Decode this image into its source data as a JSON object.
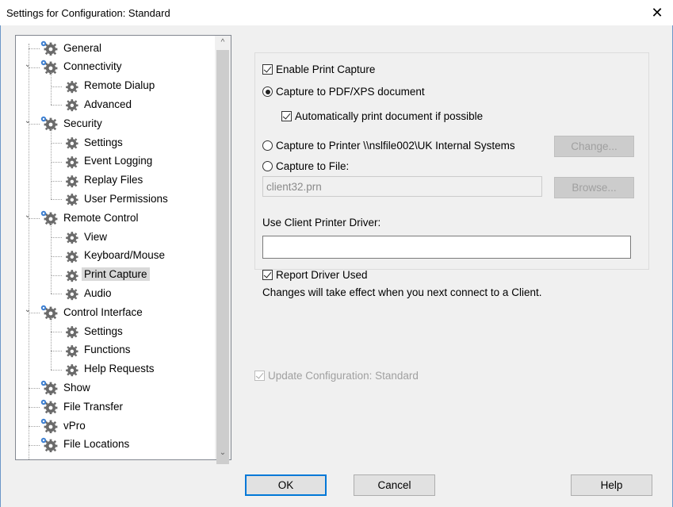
{
  "window": {
    "title": "Settings for Configuration: Standard",
    "close_label": "✕"
  },
  "tree": {
    "items": [
      {
        "label": "General",
        "level": 0,
        "expander": ""
      },
      {
        "label": "Connectivity",
        "level": 0,
        "expander": "⌄"
      },
      {
        "label": "Remote Dialup",
        "level": 1
      },
      {
        "label": "Advanced",
        "level": 1
      },
      {
        "label": "Security",
        "level": 0,
        "expander": "⌄"
      },
      {
        "label": "Settings",
        "level": 1
      },
      {
        "label": "Event Logging",
        "level": 1
      },
      {
        "label": "Replay Files",
        "level": 1
      },
      {
        "label": "User Permissions",
        "level": 1
      },
      {
        "label": "Remote Control",
        "level": 0,
        "expander": "⌄"
      },
      {
        "label": "View",
        "level": 1
      },
      {
        "label": "Keyboard/Mouse",
        "level": 1
      },
      {
        "label": "Print Capture",
        "level": 1,
        "selected": true
      },
      {
        "label": "Audio",
        "level": 1
      },
      {
        "label": "Control Interface",
        "level": 0,
        "expander": "⌄"
      },
      {
        "label": "Settings",
        "level": 1
      },
      {
        "label": "Functions",
        "level": 1
      },
      {
        "label": "Help Requests",
        "level": 1
      },
      {
        "label": "Show",
        "level": 0
      },
      {
        "label": "File Transfer",
        "level": 0
      },
      {
        "label": "vPro",
        "level": 0
      },
      {
        "label": "File Locations",
        "level": 0
      }
    ],
    "scroll_up": "^",
    "scroll_down": "⌄"
  },
  "print_capture": {
    "enable_label": "Enable Print Capture",
    "capture_pdf_label": "Capture to PDF/XPS document",
    "auto_print_label": "Automatically print document if possible",
    "capture_printer_label": "Capture to Printer \\\\nslfile002\\UK Internal Systems",
    "change_button": "Change...",
    "capture_file_label": "Capture to File:",
    "file_value": "client32.prn",
    "browse_button": "Browse...",
    "driver_label": "Use Client Printer Driver:",
    "driver_value": "",
    "report_driver_label": "Report Driver Used",
    "notice": "Changes will take effect when you next connect to a Client."
  },
  "update_config_label": "Update Configuration: Standard",
  "footer": {
    "ok": "OK",
    "cancel": "Cancel",
    "help": "Help"
  }
}
